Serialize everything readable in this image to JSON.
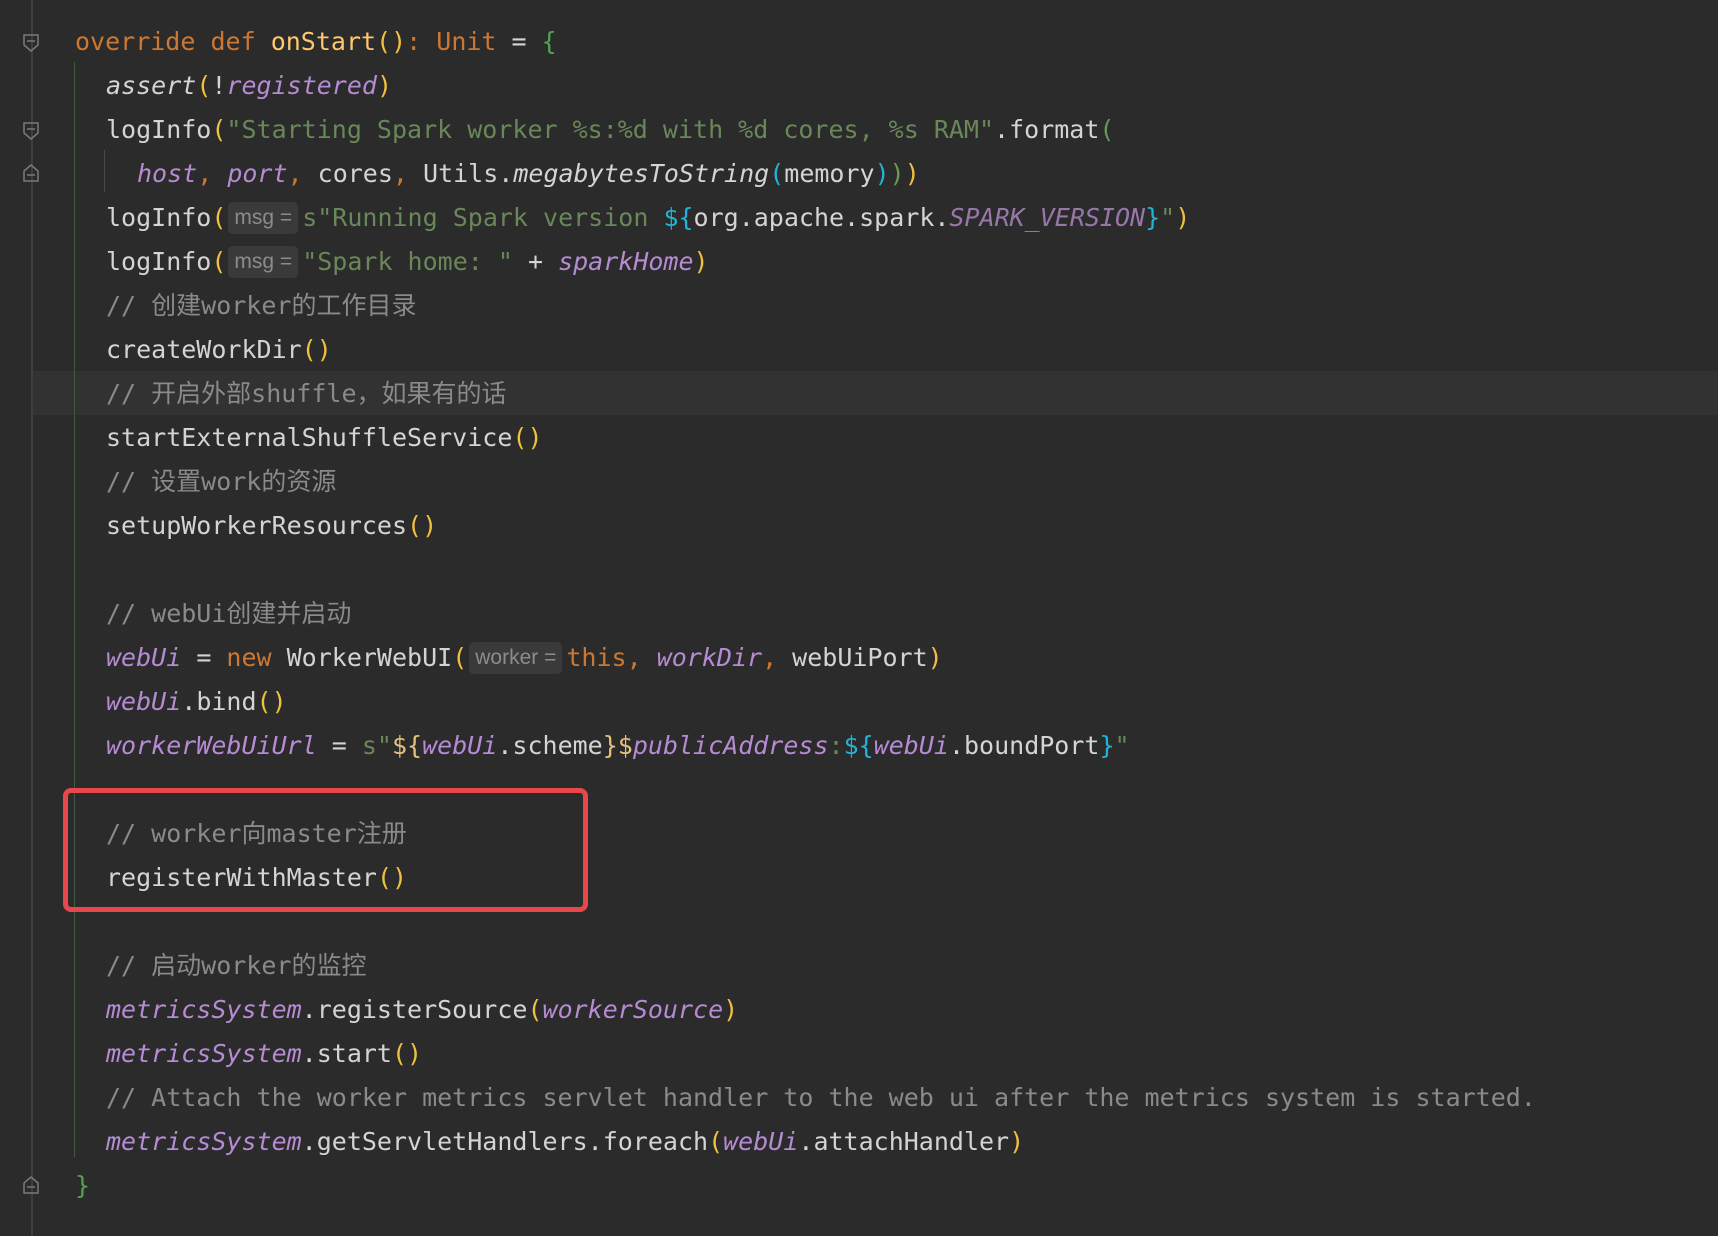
{
  "colors": {
    "background": "#2b2b2b",
    "keyword": "#cc7832",
    "function": "#ffc66d",
    "string": "#6a8759",
    "field": "#b68bd4",
    "comment": "#8a8a8a",
    "interpolation": "#21b3d8",
    "highlight_box": "#e8474b"
  },
  "icons": {
    "fold_open": "fold-open-icon",
    "fold_close": "fold-close-icon"
  },
  "code": {
    "l1": {
      "t1": "override",
      "t2": " ",
      "t3": "def",
      "t4": " ",
      "t5": "onStart",
      "t6": "()",
      "t7": ": ",
      "t8": "Unit",
      "t9": " = ",
      "t10": "{"
    },
    "l2": {
      "t1": "assert",
      "t2": "(",
      "t3": "!",
      "t4": "registered",
      "t5": ")"
    },
    "l3": {
      "t1": "logInfo",
      "t2": "(",
      "t3": "\"Starting Spark worker %s:%d with %d cores, %s RAM\"",
      "t4": ".format",
      "t5": "("
    },
    "l4": {
      "t1": "host",
      "t2": ", ",
      "t3": "port",
      "t4": ", ",
      "t5": "cores",
      "t6": ", ",
      "t7": "Utils.",
      "t8": "megabytesToString",
      "t9": "(",
      "t10": "memory",
      "t11": ")",
      "t12": ")",
      "t13": ")"
    },
    "l5": {
      "t1": "logInfo",
      "t2": "(",
      "hint": "msg =",
      "t3": "s\"Running Spark version ",
      "t4": "${",
      "t5": "org.apache.spark.",
      "t6": "SPARK_VERSION",
      "t7": "}",
      "t8": "\"",
      "t9": ")"
    },
    "l6": {
      "t1": "logInfo",
      "t2": "(",
      "hint": "msg =",
      "t3": "\"Spark home: \"",
      "t4": " + ",
      "t5": "sparkHome",
      "t6": ")"
    },
    "l7": {
      "t1": "// 创建worker的工作目录"
    },
    "l8": {
      "t1": "createWorkDir",
      "t2": "()"
    },
    "l9": {
      "t1": "// 开启外部shuffle，如果有的话"
    },
    "l10": {
      "t1": "startExternalShuffleService",
      "t2": "()"
    },
    "l11": {
      "t1": "// 设置work的资源"
    },
    "l12": {
      "t1": "setupWorkerResources",
      "t2": "()"
    },
    "l14": {
      "t1": "// webUi创建并启动"
    },
    "l15": {
      "t1": "webUi",
      "t2": " = ",
      "t3": "new",
      "t4": " WorkerWebUI",
      "t5": "(",
      "hint": "worker =",
      "t6": "this",
      "t7": ", ",
      "t8": "workDir",
      "t9": ", ",
      "t10": "webUiPort",
      "t11": ")"
    },
    "l16": {
      "t1": "webUi",
      "t2": ".bind",
      "t3": "()"
    },
    "l17": {
      "t1": "workerWebUiUrl",
      "t2": " = ",
      "t3": "s\"",
      "t4": "${",
      "t5": "webUi",
      "t6": ".scheme",
      "t7": "}",
      "t8": "$",
      "t9": "publicAddress",
      "t10": ":",
      "t11": "${",
      "t12": "webUi",
      "t13": ".boundPort",
      "t14": "}",
      "t15": "\""
    },
    "l19": {
      "t1": "// worker向master注册"
    },
    "l20": {
      "t1": "registerWithMaster",
      "t2": "()"
    },
    "l22": {
      "t1": "// 启动worker的监控"
    },
    "l23": {
      "t1": "metricsSystem",
      "t2": ".registerSource",
      "t3": "(",
      "t4": "workerSource",
      "t5": ")"
    },
    "l24": {
      "t1": "metricsSystem",
      "t2": ".start",
      "t3": "()"
    },
    "l25": {
      "t1": "// Attach the worker metrics servlet handler to the web ui after the metrics system is started."
    },
    "l26": {
      "t1": "metricsSystem",
      "t2": ".getServletHandlers.foreach",
      "t3": "(",
      "t4": "webUi",
      "t5": ".attachHandler",
      "t6": ")"
    },
    "l27": {
      "t1": "}"
    }
  }
}
